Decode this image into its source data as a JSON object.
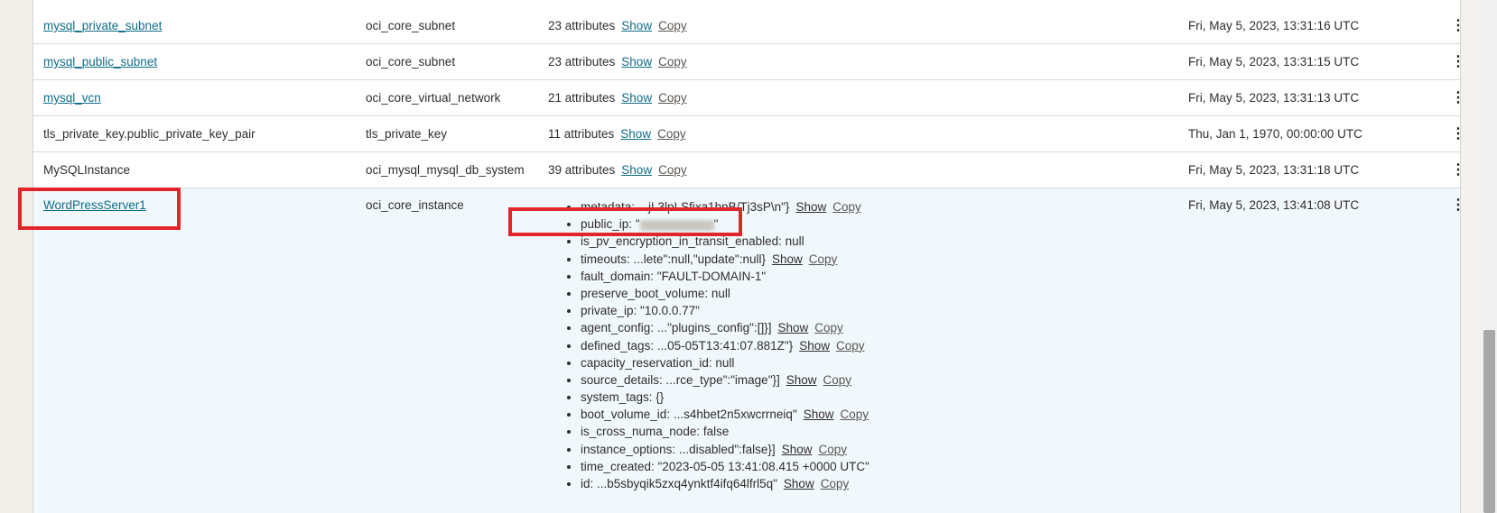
{
  "rows": [
    {
      "name": "mysql_private_subnet",
      "type": "oci_core_subnet",
      "attributes": "23 attributes",
      "show": "Show",
      "copy": "Copy",
      "date": "Fri, May 5, 2023, 13:31:16 UTC"
    },
    {
      "name": "mysql_public_subnet",
      "type": "oci_core_subnet",
      "attributes": "23 attributes",
      "show": "Show",
      "copy": "Copy",
      "date": "Fri, May 5, 2023, 13:31:15 UTC"
    },
    {
      "name": "mysql_vcn",
      "type": "oci_core_virtual_network",
      "attributes": "21 attributes",
      "show": "Show",
      "copy": "Copy",
      "date": "Fri, May 5, 2023, 13:31:13 UTC"
    },
    {
      "name": "tls_private_key.public_private_key_pair",
      "type": "tls_private_key",
      "attributes": "11 attributes",
      "show": "Show",
      "copy": "Copy",
      "date": "Thu, Jan 1, 1970, 00:00:00 UTC"
    },
    {
      "name": "MySQLInstance",
      "type": "oci_mysql_mysql_db_system",
      "attributes": "39 attributes",
      "show": "Show",
      "copy": "Copy",
      "date": "Fri, May 5, 2023, 13:31:18 UTC"
    }
  ],
  "selected": {
    "name": "WordPressServer1",
    "type": "oci_core_instance",
    "date": "Fri, May 5, 2023, 13:41:08 UTC",
    "show": "Show",
    "copy": "Copy",
    "attrs": [
      {
        "text": "metadata: ...jL3lpLSfixa1hnB/Tj3sP\\n\"}",
        "actions": true
      },
      {
        "text": "public_ip: \"",
        "suffix": "\"",
        "blurred": true,
        "actions": false
      },
      {
        "text": "is_pv_encryption_in_transit_enabled: null",
        "actions": false
      },
      {
        "text": "timeouts: ...lete\":null,\"update\":null}",
        "actions": true
      },
      {
        "text": "fault_domain: \"FAULT-DOMAIN-1\"",
        "actions": false
      },
      {
        "text": "preserve_boot_volume: null",
        "actions": false
      },
      {
        "text": "private_ip: \"10.0.0.77\"",
        "actions": false
      },
      {
        "text": "agent_config: ...\"plugins_config\":[]}]",
        "actions": true
      },
      {
        "text": "defined_tags: ...05-05T13:41:07.881Z\"}",
        "actions": true
      },
      {
        "text": "capacity_reservation_id: null",
        "actions": false
      },
      {
        "text": "source_details: ...rce_type\":\"image\"}]",
        "actions": true
      },
      {
        "text": "system_tags: {}",
        "actions": false
      },
      {
        "text": "boot_volume_id: ...s4hbet2n5xwcrrneiq\"",
        "actions": true
      },
      {
        "text": "is_cross_numa_node: false",
        "actions": false
      },
      {
        "text": "instance_options: ...disabled\":false}]",
        "actions": true
      },
      {
        "text": "time_created: \"2023-05-05 13:41:08.415 +0000 UTC\"",
        "actions": false
      },
      {
        "text": "id: ...b5sbyqik5zxq4ynktf4ifq64lfrl5q\"",
        "actions": true
      }
    ]
  },
  "kebab_glyph": "⋮"
}
